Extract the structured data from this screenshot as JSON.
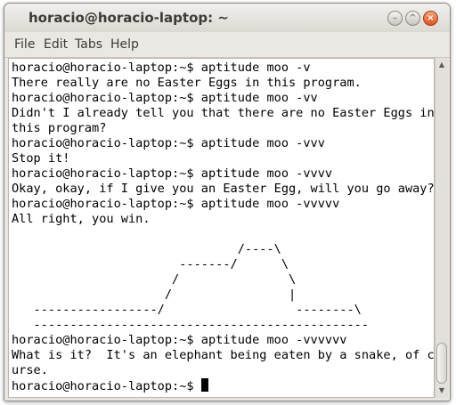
{
  "window": {
    "title": "horacio@horacio-laptop: ~",
    "buttons": {
      "minimize": "–",
      "maximize": "^",
      "close": "×"
    }
  },
  "menubar": {
    "items": [
      "File",
      "Edit",
      "Tabs",
      "Help"
    ]
  },
  "terminal": {
    "lines": [
      "horacio@horacio-laptop:~$ aptitude moo -v",
      "There really are no Easter Eggs in this program.",
      "horacio@horacio-laptop:~$ aptitude moo -vv",
      "Didn't I already tell you that there are no Easter Eggs in",
      "this program?",
      "horacio@horacio-laptop:~$ aptitude moo -vvv",
      "Stop it!",
      "horacio@horacio-laptop:~$ aptitude moo -vvvv",
      "Okay, okay, if I give you an Easter Egg, will you go away?",
      "horacio@horacio-laptop:~$ aptitude moo -vvvvv",
      "All right, you win.",
      "",
      "                               /----\\",
      "                       -------/      \\",
      "                      /               \\",
      "                     /                |",
      "   -----------------/                  --------\\",
      "   ----------------------------------------------",
      "horacio@horacio-laptop:~$ aptitude moo -vvvvvv",
      "What is it?  It's an elephant being eaten by a snake, of co",
      "urse.",
      "horacio@horacio-laptop:~$ "
    ]
  },
  "scrollbar": {
    "up_arrow": "▲",
    "down_arrow": "▼"
  }
}
